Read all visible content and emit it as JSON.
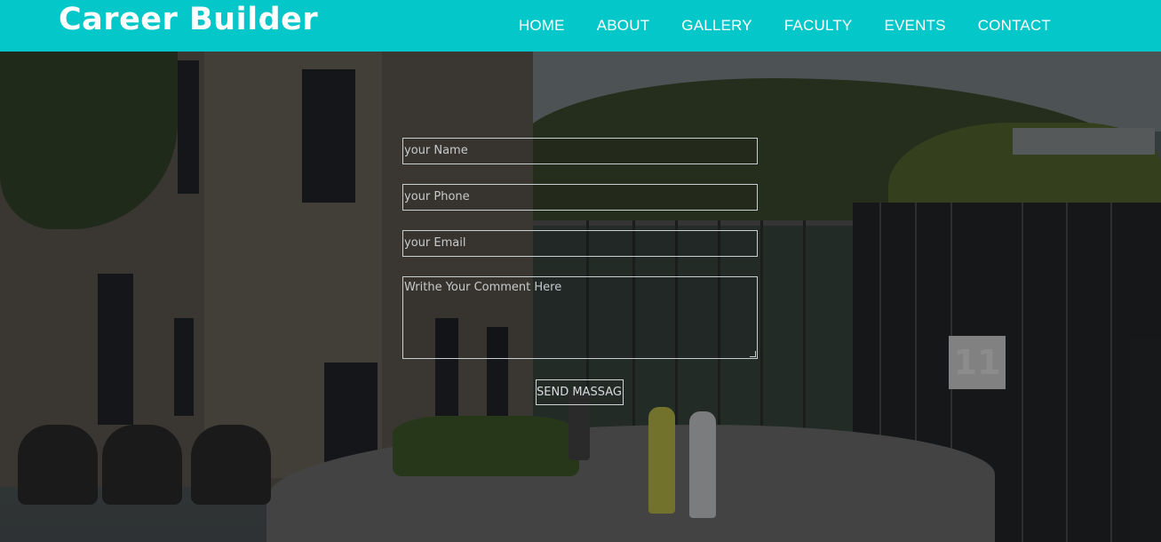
{
  "brand": "Career Builder",
  "nav": [
    "HOME",
    "ABOUT",
    "GALLERY",
    "FACULTY",
    "EVENTS",
    "CONTACT"
  ],
  "form": {
    "name_placeholder": "your Name",
    "phone_placeholder": "your Phone",
    "email_placeholder": "your Email",
    "comment_placeholder": "Writhe Your Comment Here",
    "send_label": "SEND MASSAG"
  },
  "hero": {
    "sign_text": "11"
  },
  "colors": {
    "navbar": "#04c7c9",
    "text": "#ffffff"
  }
}
